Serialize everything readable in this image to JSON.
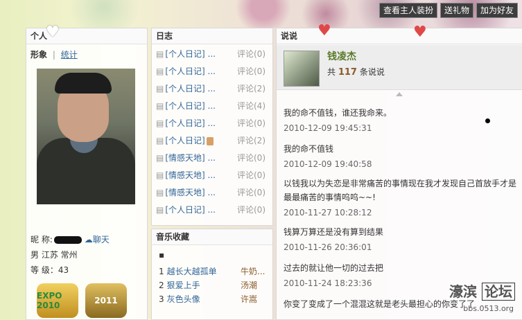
{
  "top_buttons": [
    "查看主人装扮",
    "送礼物",
    "加为好友"
  ],
  "profile": {
    "header": "个人",
    "tab_active": "形象",
    "tab_sep": "|",
    "tab_link": "统计",
    "nickname_label": "昵  称:",
    "chat": "聊天",
    "location": "男  江苏  常州",
    "level": "等  级：43",
    "badge1": "EXPO 2010",
    "badge2": "2011"
  },
  "diary": {
    "header": "日志",
    "rows": [
      {
        "cat": "[个人日记] ...",
        "cmt": "评论(0)"
      },
      {
        "cat": "[个人日记] ...",
        "cmt": "评论(0)"
      },
      {
        "cat": "[个人日记] ...",
        "cmt": "评论(2)"
      },
      {
        "cat": "[个人日记] ...",
        "cmt": "评论(4)"
      },
      {
        "cat": "[个人日记] ...",
        "cmt": "评论(0)"
      },
      {
        "cat": "[个人日记]",
        "cmt": "评论(2)"
      },
      {
        "cat": "[情感天地] ...",
        "cmt": "评论(0)"
      },
      {
        "cat": "[情感天地] ...",
        "cmt": "评论(0)"
      },
      {
        "cat": "[情感天地] ...",
        "cmt": "评论(0)"
      },
      {
        "cat": "[个人日记] ...",
        "cmt": "评论(0)"
      }
    ]
  },
  "music": {
    "header": "音乐收藏",
    "player": "▪",
    "rows": [
      {
        "num": "1",
        "title": "越长大越孤单",
        "artist": "牛奶..."
      },
      {
        "num": "2",
        "title": "狠爱上手",
        "artist": "汤潮"
      },
      {
        "num": "3",
        "title": "灰色头像",
        "artist": "许嵩"
      }
    ]
  },
  "say": {
    "header": "说说",
    "user": "钱凌杰",
    "count_prefix": "共",
    "count": "117",
    "count_suffix": "条说说",
    "posts": [
      {
        "text": "我的命不值钱，谁还我命来。",
        "time": "2010-12-09 19:45:31"
      },
      {
        "text": "我的命不值钱",
        "time": "2010-12-09 19:40:58"
      },
      {
        "text": "以钱我以为失恋是非常痛苦的事情现在我才发现自己首放手才是最最痛苦的事情呜呜~~!",
        "time": "2010-11-27 10:28:12"
      },
      {
        "text": "钱算万算还是没有算到结果",
        "time": "2010-11-26 20:36:01"
      },
      {
        "text": "过去的就让他一切的过去把",
        "time": "2010-11-24 18:23:36"
      },
      {
        "text": "你变了变成了一个混混这就是老头最担心的你变了了",
        "time": ""
      }
    ]
  },
  "watermark": {
    "text1": "濠滨",
    "text2": "论坛",
    "url": "bbs.0513.org"
  }
}
